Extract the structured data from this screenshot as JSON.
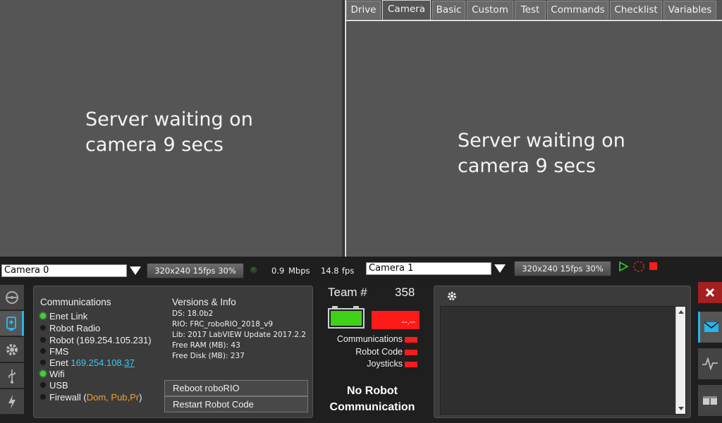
{
  "tabs": [
    "Drive",
    "Camera",
    "Basic",
    "Custom",
    "Test",
    "Commands",
    "Checklist",
    "Variables"
  ],
  "active_tab": "Camera",
  "left_camera": {
    "message": "Server waiting on\ncamera 9 secs"
  },
  "right_camera": {
    "message": "Server waiting on\ncamera 9 secs"
  },
  "camera_controls": {
    "left_select": "Camera 0",
    "left_res": "320x240   15fps   30%",
    "bandwidth_value": "0.9",
    "bandwidth_unit": "Mbps",
    "fps_value": "14.8",
    "fps_unit": "fps",
    "right_select": "Camera 1",
    "right_res": "320x240   15fps   30%"
  },
  "diagnostics": {
    "comm_title": "Communications",
    "comm_items": [
      {
        "label": "Enet Link",
        "on": true
      },
      {
        "label": "Robot Radio",
        "on": false
      },
      {
        "label": "Robot (169.254.105.231)",
        "on": false
      },
      {
        "label": "FMS",
        "on": false
      },
      {
        "label": "Enet ",
        "ip_a": "169.254.108.",
        "ip_b": "37",
        "on": false
      },
      {
        "label": "Wifi",
        "on": true
      },
      {
        "label": "USB",
        "on": false
      },
      {
        "label": "Firewall (",
        "fw_values": "Dom, Pub,Pr",
        "fw_close": ")",
        "on": false
      }
    ],
    "versions_title": "Versions & Info",
    "versions": [
      "DS:  18.0b2",
      "RIO:  FRC_roboRIO_2018_v9",
      "Lib:  2017 LabVIEW Update 2017.2.2",
      "Free RAM (MB): 43",
      "Free Disk (MB): 237"
    ],
    "reboot_label": "Reboot roboRIO",
    "restart_label": "Restart Robot Code"
  },
  "status": {
    "team_label": "Team #",
    "team_number": "358",
    "voltage": "--.--",
    "indicators": [
      "Communications",
      "Robot Code",
      "Joysticks"
    ],
    "message": "No Robot\nCommunication"
  },
  "colors": {
    "accent_blue": "#28b4e8",
    "led_green": "#39d62b",
    "alert_red": "#ff1a1a",
    "firewall_orange": "#f0a030",
    "enet_cyan": "#3cc8f0"
  },
  "icons": {
    "left_sidebar": [
      "steering-wheel-icon",
      "diagnostics-icon",
      "gear-icon",
      "usb-icon",
      "power-icon"
    ],
    "right_sidebar": [
      "close-icon",
      "messages-icon",
      "charts-icon",
      "both-icon"
    ]
  }
}
